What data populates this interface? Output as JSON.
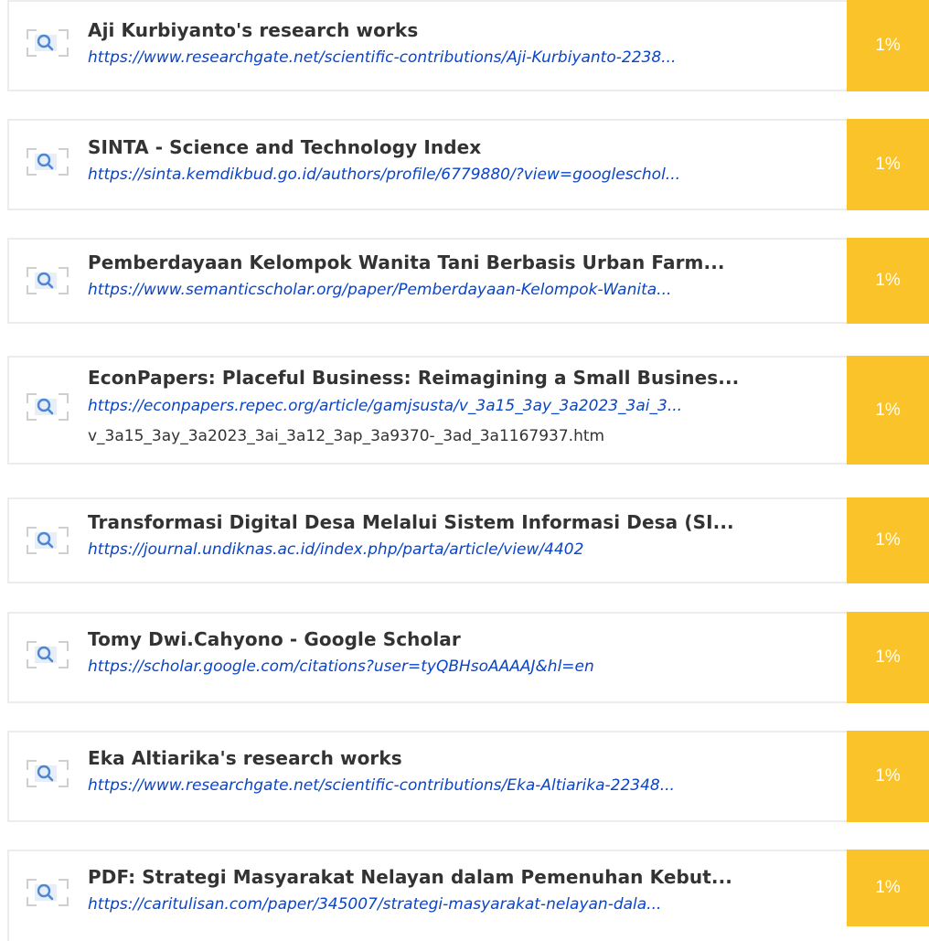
{
  "accent_color": "#fbc32a",
  "link_color": "#0a45c6",
  "sources": [
    {
      "title": "Aji Kurbiyanto's research works",
      "url": "https://www.researchgate.net/scientific-contributions/Aji-Kurbiyanto-2238...",
      "extra": "",
      "percent": "1%",
      "icon": "search-document-icon"
    },
    {
      "title": "SINTA - Science and Technology Index",
      "url": "https://sinta.kemdikbud.go.id/authors/profile/6779880/?view=googleschol...",
      "extra": "",
      "percent": "1%",
      "icon": "search-document-icon"
    },
    {
      "title": "Pemberdayaan Kelompok Wanita Tani Berbasis Urban Farm...",
      "url": "https://www.semanticscholar.org/paper/Pemberdayaan-Kelompok-Wanita...",
      "extra": "",
      "percent": "1%",
      "icon": "search-document-icon"
    },
    {
      "title": "EconPapers: Placeful Business: Reimagining a Small Busines...",
      "url": "https://econpapers.repec.org/article/gamjsusta/v_3a15_3ay_3a2023_3ai_3...",
      "extra": "v_3a15_3ay_3a2023_3ai_3a12_3ap_3a9370-_3ad_3a1167937.htm",
      "percent": "1%",
      "icon": "search-document-icon"
    },
    {
      "title": "Transformasi Digital Desa Melalui Sistem Informasi Desa (SI...",
      "url": "https://journal.undiknas.ac.id/index.php/parta/article/view/4402",
      "extra": "",
      "percent": "1%",
      "icon": "search-document-icon"
    },
    {
      "title": "Tomy Dwi.Cahyono - Google Scholar",
      "url": "https://scholar.google.com/citations?user=tyQBHsoAAAAJ&hl=en",
      "extra": "",
      "percent": "1%",
      "icon": "search-document-icon"
    },
    {
      "title": "Eka Altiarika's research works",
      "url": "https://www.researchgate.net/scientific-contributions/Eka-Altiarika-22348...",
      "extra": "",
      "percent": "1%",
      "icon": "search-document-icon"
    },
    {
      "title": "PDF: Strategi Masyarakat Nelayan dalam Pemenuhan Kebut...",
      "url": "https://caritulisan.com/paper/345007/strategi-masyarakat-nelayan-dala...",
      "extra": "",
      "percent": "1%",
      "icon": "search-document-icon"
    }
  ]
}
